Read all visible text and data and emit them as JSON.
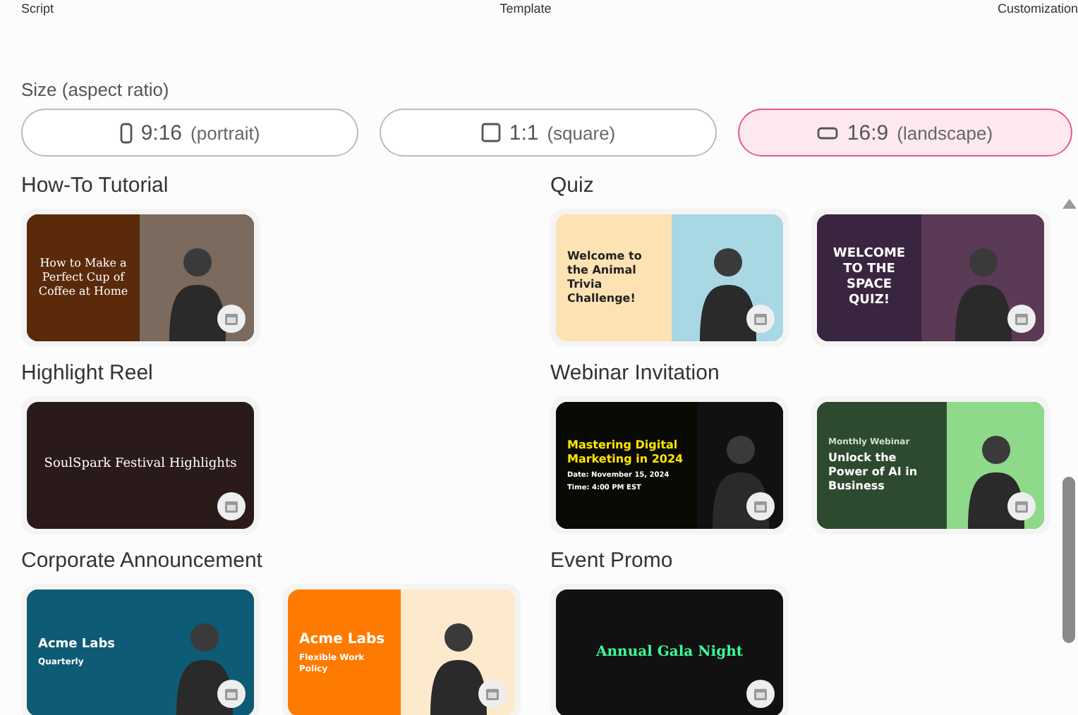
{
  "steps": [
    "Script",
    "Template",
    "Customization"
  ],
  "size": {
    "label": "Size (aspect ratio)",
    "options": [
      {
        "kind": "portrait",
        "ratio": "9:16",
        "note": "(portrait)",
        "selected": false
      },
      {
        "kind": "square",
        "ratio": "1:1",
        "note": "(square)",
        "selected": false
      },
      {
        "kind": "landscape",
        "ratio": "16:9",
        "note": "(landscape)",
        "selected": true
      }
    ]
  },
  "sections": [
    {
      "title": "How-To Tutorial",
      "templates": [
        {
          "lines": [
            "How to Make a Perfect Cup of Coffee at Home"
          ]
        }
      ]
    },
    {
      "title": "Quiz",
      "templates": [
        {
          "lines": [
            "Welcome to the Animal Trivia Challenge!"
          ]
        },
        {
          "lines": [
            "WELCOME TO THE SPACE QUIZ!"
          ]
        }
      ]
    },
    {
      "title": "Highlight Reel",
      "templates": [
        {
          "lines": [
            "SoulSpark Festival Highlights"
          ]
        }
      ]
    },
    {
      "title": "Webinar Invitation",
      "templates": [
        {
          "lines": [
            "Mastering Digital Marketing in 2024",
            "Date: November 15, 2024",
            "Time: 4:00 PM EST"
          ]
        },
        {
          "lines": [
            "Monthly Webinar",
            "Unlock the Power of AI in Business"
          ]
        }
      ]
    },
    {
      "title": "Corporate Announcement",
      "templates": [
        {
          "lines": [
            "Acme Labs",
            "Quarterly"
          ]
        },
        {
          "lines": [
            "Acme Labs",
            "Flexible Work Policy"
          ]
        }
      ]
    },
    {
      "title": "Event Promo",
      "templates": [
        {
          "lines": [
            "Annual Gala Night"
          ]
        }
      ]
    }
  ]
}
